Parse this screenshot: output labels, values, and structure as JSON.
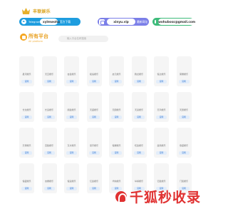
{
  "header": {
    "logo_text": "丰联娱乐",
    "telegram": {
      "label": "Telegram:",
      "value": "xylmwohu",
      "button": "官方下载"
    },
    "url": {
      "value": "xinyu.vip",
      "button": "最新网址"
    },
    "email": {
      "value": "wohuboss@gmail.com"
    }
  },
  "section": {
    "title": "所有平台",
    "subtitle": "All platform",
    "search_placeholder": "输入平台名称搜索"
  },
  "platforms": [
    {
      "name": "星河娱乐",
      "action": "官网"
    },
    {
      "name": "天空娱乐",
      "action": "官网"
    },
    {
      "name": "杏鑫娱乐",
      "action": "官网"
    },
    {
      "name": "极速娱乐",
      "action": "官网"
    },
    {
      "name": "启元娱乐",
      "action": "官网"
    },
    {
      "name": "腾龙娱乐",
      "action": "官网"
    },
    {
      "name": "恒达娱乐",
      "action": "官网"
    },
    {
      "name": "荣耀娱乐",
      "action": "官网"
    },
    {
      "name": "长龙娱乐",
      "action": "官网"
    },
    {
      "name": "长运娱乐",
      "action": "官网"
    },
    {
      "name": "顺鑫娱乐",
      "action": "官网"
    },
    {
      "name": "天盛娱乐",
      "action": "官网"
    },
    {
      "name": "天朗娱乐",
      "action": "官网"
    },
    {
      "name": "天蓝娱乐",
      "action": "官网"
    },
    {
      "name": "天鸿娱乐",
      "action": "官网"
    },
    {
      "name": "天辰娱乐",
      "action": "官网"
    },
    {
      "name": "天博娱乐",
      "action": "官网"
    },
    {
      "name": "百胜娱乐",
      "action": "官网"
    },
    {
      "name": "东方娱乐",
      "action": "官网"
    },
    {
      "name": "恩宇娱乐",
      "action": "官网"
    },
    {
      "name": "恒耀娱乐",
      "action": "官网"
    },
    {
      "name": "旺鑫娱乐",
      "action": "官网"
    },
    {
      "name": "鑫鼎娱乐",
      "action": "官网"
    },
    {
      "name": "鼎盛娱乐",
      "action": "官网"
    },
    {
      "name": "恒盛娱乐",
      "action": "官网"
    },
    {
      "name": "杏耀娱乐",
      "action": "官网"
    },
    {
      "name": "恒运娱乐",
      "action": "官网"
    },
    {
      "name": "亿鑫娱乐",
      "action": "官网"
    },
    {
      "name": "华纳娱乐",
      "action": "官网"
    },
    {
      "name": "纵横娱乐",
      "action": "官网"
    },
    {
      "name": "亿胜娱乐",
      "action": "官网"
    },
    {
      "name": "门徒娱乐",
      "action": "官网"
    }
  ],
  "watermark": {
    "text": "千狐秒收录",
    "accent_color": "#e03131"
  }
}
